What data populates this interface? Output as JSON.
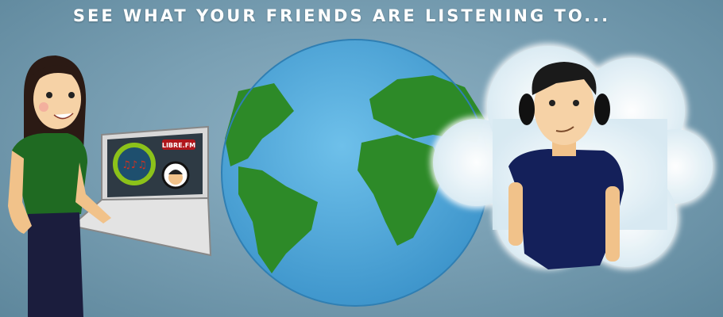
{
  "banner": {
    "headline": "SEE WHAT YOUR FRIENDS ARE LISTENING TO...",
    "laptop_logo": "LIBRE.FM"
  },
  "colors": {
    "ocean": "#4fa6d8",
    "land": "#2f8a2a",
    "shirt_woman": "#1f6a22",
    "shirt_man": "#14205a",
    "logo_ring": "#8cc21a",
    "logo_badge": "#b0161b"
  }
}
